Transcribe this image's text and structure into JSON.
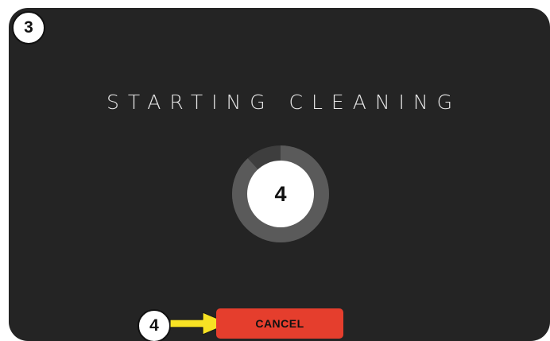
{
  "step_badges": {
    "top_left": "3",
    "bottom": "4"
  },
  "screen": {
    "title": "STARTING CLEANING",
    "countdown_value": "4",
    "progress_fraction": 0.88,
    "cancel_label": "CANCEL"
  },
  "colors": {
    "screen_background": "#242424",
    "ring_track": "#3e3e3e",
    "ring_fill": "#5a5a5a",
    "cancel_button": "#e53e2d",
    "arrow": "#f7e224"
  },
  "icons": {
    "pointer": "arrow-right-icon"
  }
}
